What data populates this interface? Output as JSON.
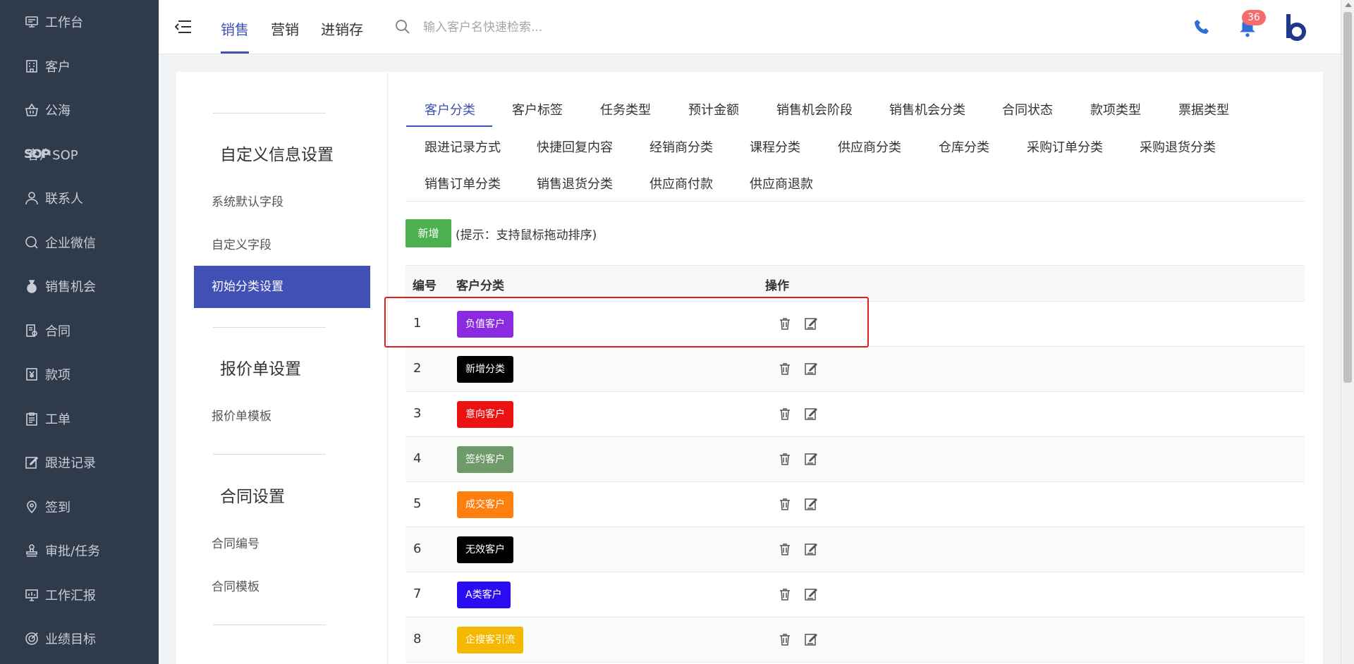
{
  "sidebar": {
    "items": [
      {
        "label": "工作台",
        "icon": "desktop-icon"
      },
      {
        "label": "客户",
        "icon": "building-icon"
      },
      {
        "label": "公海",
        "icon": "basket-icon"
      },
      {
        "label": "客户SOP",
        "icon": "sop-icon"
      },
      {
        "label": "联系人",
        "icon": "person-icon"
      },
      {
        "label": "企业微信",
        "icon": "chat-icon"
      },
      {
        "label": "销售机会",
        "icon": "money-bag-icon"
      },
      {
        "label": "合同",
        "icon": "contract-icon"
      },
      {
        "label": "款项",
        "icon": "yen-icon"
      },
      {
        "label": "工单",
        "icon": "clipboard-icon"
      },
      {
        "label": "跟进记录",
        "icon": "edit-icon"
      },
      {
        "label": "签到",
        "icon": "location-icon"
      },
      {
        "label": "审批/任务",
        "icon": "stamp-icon"
      },
      {
        "label": "工作汇报",
        "icon": "presentation-icon"
      },
      {
        "label": "业绩目标",
        "icon": "target-icon"
      }
    ],
    "sop_prefix": "SOP"
  },
  "topbar": {
    "tabs": [
      "销售",
      "营销",
      "进销存"
    ],
    "active_tab": "销售",
    "search_placeholder": "输入客户名快速检索...",
    "notification_count": "36"
  },
  "settings_nav": {
    "sections": [
      {
        "heading": "自定义信息设置",
        "links": [
          "系统默认字段",
          "自定义字段",
          "初始分类设置"
        ]
      },
      {
        "heading": "报价单设置",
        "links": [
          "报价单模板"
        ]
      },
      {
        "heading": "合同设置",
        "links": [
          "合同编号",
          "合同模板"
        ]
      }
    ],
    "active_link": "初始分类设置"
  },
  "category_tabs": [
    [
      "客户分类",
      "客户标签",
      "任务类型",
      "预计金额",
      "销售机会阶段",
      "销售机会分类",
      "合同状态",
      "款项类型",
      "票据类型"
    ],
    [
      "跟进记录方式",
      "快捷回复内容",
      "经销商分类",
      "课程分类",
      "供应商分类",
      "仓库分类",
      "采购订单分类",
      "采购退货分类"
    ],
    [
      "销售订单分类",
      "销售退货分类",
      "供应商付款",
      "供应商退款"
    ]
  ],
  "active_category_tab": "客户分类",
  "toolbar": {
    "add_label": "新增",
    "hint": "(提示：支持鼠标拖动排序)"
  },
  "table": {
    "headers": [
      "编号",
      "客户分类",
      "操作"
    ],
    "rows": [
      {
        "num": "1",
        "label": "负值客户",
        "color": "#8a2be2"
      },
      {
        "num": "2",
        "label": "新增分类",
        "color": "#000000"
      },
      {
        "num": "3",
        "label": "意向客户",
        "color": "#ee1111"
      },
      {
        "num": "4",
        "label": "签约客户",
        "color": "#6f9a6a"
      },
      {
        "num": "5",
        "label": "成交客户",
        "color": "#ff7f0e"
      },
      {
        "num": "6",
        "label": "无效客户",
        "color": "#000000"
      },
      {
        "num": "7",
        "label": "A类客户",
        "color": "#2a0cf0"
      },
      {
        "num": "8",
        "label": "企搜客引流",
        "color": "#f5b800"
      }
    ]
  },
  "colors": {
    "sidebar_bg": "#2f3a4a",
    "accent": "#3f51b5",
    "add_button": "#4caf50",
    "highlight_border": "#e02020"
  }
}
